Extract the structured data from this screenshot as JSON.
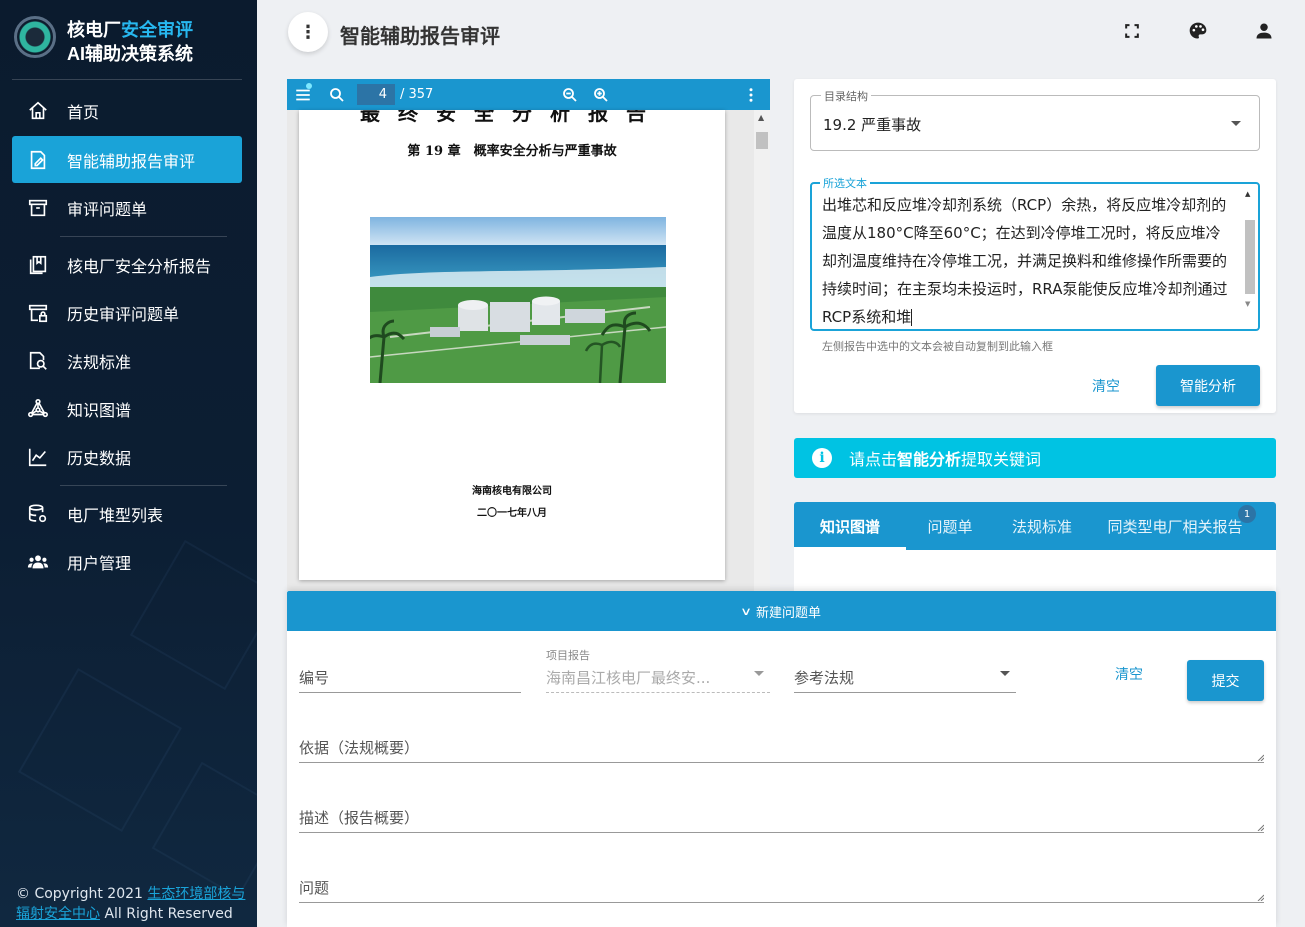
{
  "sidebar": {
    "brand_line1_part1": "核电厂",
    "brand_line1_part2": "安全审评",
    "brand_line2": "AI辅助决策系统",
    "items": [
      {
        "label": "首页",
        "icon": "home-icon"
      },
      {
        "label": "智能辅助报告审评",
        "icon": "edit-document-icon",
        "active": true
      },
      {
        "label": "审评问题单",
        "icon": "archive-box-icon"
      },
      {
        "label": "核电厂安全分析报告",
        "icon": "book-icon"
      },
      {
        "label": "历史审评问题单",
        "icon": "locked-archive-icon"
      },
      {
        "label": "法规标准",
        "icon": "document-search-icon"
      },
      {
        "label": "知识图谱",
        "icon": "graph-network-icon"
      },
      {
        "label": "历史数据",
        "icon": "line-chart-icon"
      },
      {
        "label": "电厂堆型列表",
        "icon": "database-gear-icon"
      },
      {
        "label": "用户管理",
        "icon": "users-icon"
      }
    ],
    "copyright_prefix": "© Copyright 2021 ",
    "copyright_link": "生态环境部核与辐射安全中心",
    "copyright_suffix": " All Right Reserved"
  },
  "header": {
    "title": "智能辅助报告审评",
    "menu_icon": "more-vert-icon",
    "icons": [
      "fullscreen-icon",
      "palette-icon",
      "account-icon"
    ]
  },
  "viewer": {
    "current_page": "4",
    "total_pages": "/ 357",
    "doc": {
      "top_title": "最终安全分析报告",
      "chapter": "第 19 章　概率安全分析与严重事故",
      "company": "海南核电有限公司",
      "date": "二〇一七年八月"
    }
  },
  "right_panel": {
    "directory_label": "目录结构",
    "directory_value": "19.2 严重事故",
    "selected_label": "所选文本",
    "selected_text": "出堆芯和反应堆冷却剂系统（RCP）余热，将反应堆冷却剂的温度从180°C降至60°C；在达到冷停堆工况时，将反应堆冷却剂温度维持在冷停堆工况，并满足换料和维修操作所需要的持续时间；在主泵均未投运时，RRA泵能使反应堆冷却剂通过RCP系统和堆",
    "hint": "左侧报告中选中的文本会被自动复制到此输入框",
    "clear_label": "清空",
    "analyze_label": "智能分析"
  },
  "alert": {
    "prefix": "请点击",
    "bold": "智能分析",
    "suffix": "提取关键词",
    "color": "#00c3e3"
  },
  "tabs": {
    "items": [
      "知识图谱",
      "问题单",
      "法规标准",
      "同类型电厂相关报告"
    ],
    "badge": "1"
  },
  "new_issue": {
    "title": "新建问题单",
    "number_label": "编号",
    "project_small": "项目报告",
    "project_value": "海南昌江核电厂最终安...",
    "regulation_label": "参考法规",
    "clear_label": "清空",
    "submit_label": "提交",
    "basis_label": "依据（法规概要）",
    "description_label": "描述（报告概要）",
    "question_label": "问题"
  },
  "colors": {
    "accent": "#1a96cf",
    "sidebar_active": "#1aa3d8",
    "sidebar_bg": "#0c1e33"
  }
}
